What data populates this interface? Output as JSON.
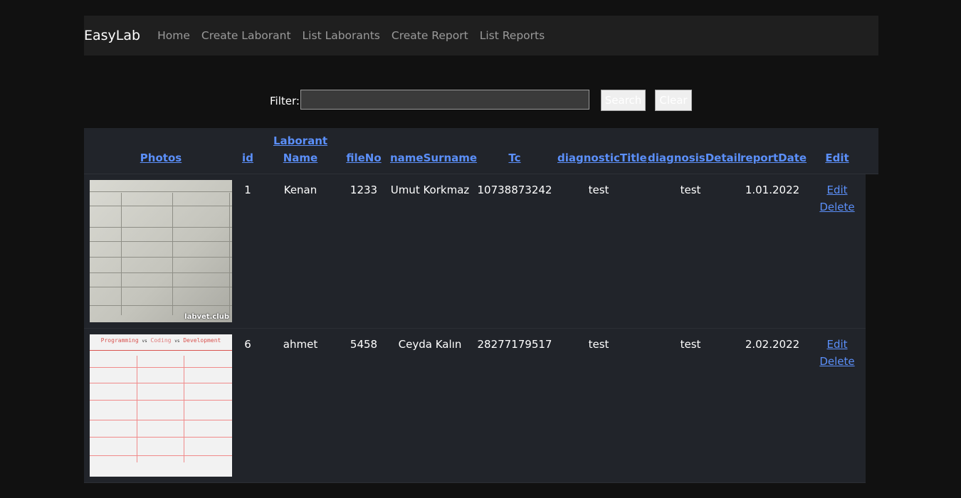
{
  "nav": {
    "brand": "EasyLab",
    "links": [
      "Home",
      "Create Laborant",
      "List Laborants",
      "Create Report",
      "List Reports"
    ]
  },
  "filter": {
    "label": "Filter:",
    "value": "",
    "search_label": "Search",
    "clear_label": "Clear"
  },
  "table": {
    "headers": {
      "photos": "Photos",
      "id": "id",
      "laborant_name_1": "Laborant",
      "laborant_name_2": "Name",
      "fileNo": "fileNo",
      "nameSurname": "nameSurname",
      "tc": "Tc",
      "diagnosticTitle": "diagnosticTitle",
      "diagnosisDetail": "diagnosisDetail",
      "reportDate": "reportDate",
      "edit": "Edit"
    },
    "rows": [
      {
        "id": "1",
        "laborant": "Kenan",
        "fileNo": "1233",
        "nameSurname": "Umut Korkmaz",
        "tc": "10738873242",
        "diagnosticTitle": "test",
        "diagnosisDetail": "test",
        "reportDate": "1.01.2022",
        "edit_label": "Edit",
        "delete_label": "Delete",
        "photo": {
          "watermark": "labvet.club"
        }
      },
      {
        "id": "6",
        "laborant": "ahmet",
        "fileNo": "5458",
        "nameSurname": "Ceyda Kalın",
        "tc": "28277179517",
        "diagnosticTitle": "test",
        "diagnosisDetail": "test",
        "reportDate": "2.02.2022",
        "edit_label": "Edit",
        "delete_label": "Delete",
        "photo": {
          "title_1": "Programming",
          "vs": "vs",
          "title_2": "Coding",
          "title_3": "Development"
        }
      }
    ]
  },
  "colors": {
    "background": "#111111",
    "navbar": "#1f1f1f",
    "table": "#21242a",
    "link": "#5b8ff9"
  }
}
